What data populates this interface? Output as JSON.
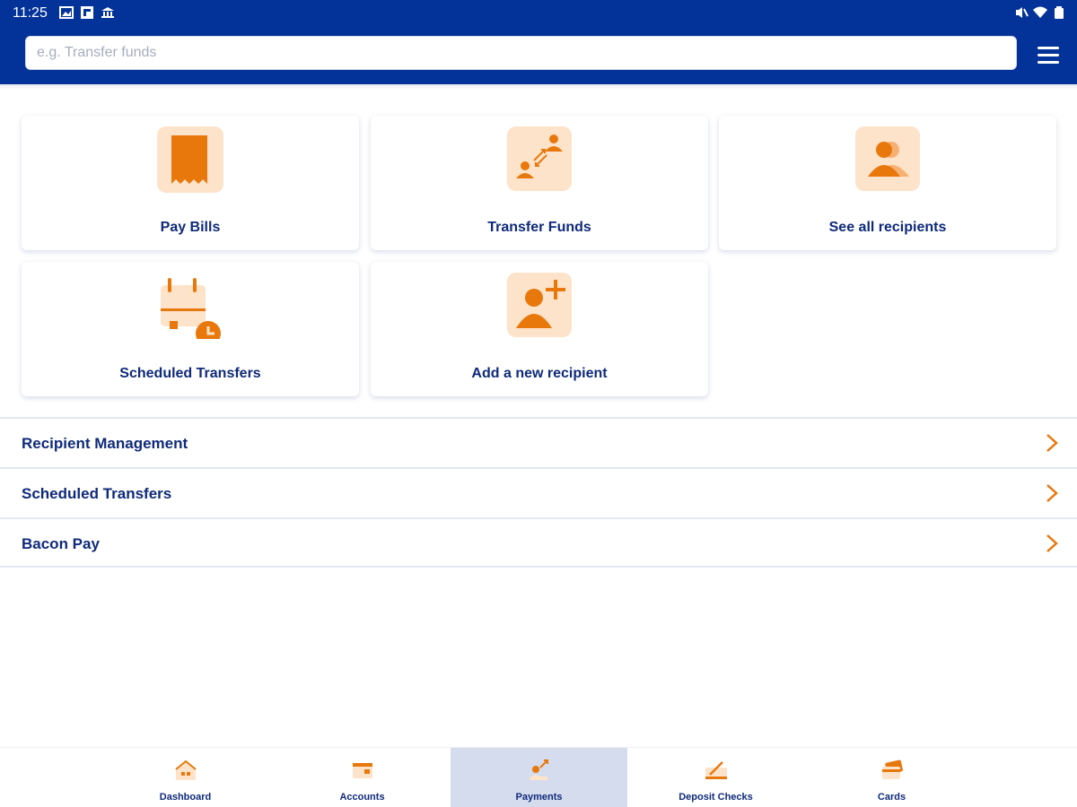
{
  "status_bar": {
    "time": "11:25"
  },
  "search": {
    "placeholder": "e.g. Transfer funds",
    "value": ""
  },
  "tiles": [
    {
      "label": "Pay Bills",
      "icon": "bill-receipt-icon"
    },
    {
      "label": "Transfer Funds",
      "icon": "transfer-people-icon"
    },
    {
      "label": "See all recipients",
      "icon": "recipients-group-icon"
    },
    {
      "label": "Scheduled Transfers",
      "icon": "calendar-clock-icon"
    },
    {
      "label": "Add a new recipient",
      "icon": "add-person-icon"
    }
  ],
  "list": [
    {
      "label": "Recipient Management"
    },
    {
      "label": "Scheduled Transfers"
    },
    {
      "label": "Bacon Pay"
    }
  ],
  "bottom_nav": {
    "items": [
      {
        "label": "Dashboard",
        "icon": "home-icon"
      },
      {
        "label": "Accounts",
        "icon": "wallet-icon"
      },
      {
        "label": "Payments",
        "icon": "payments-icon",
        "active": true
      },
      {
        "label": "Deposit Checks",
        "icon": "check-deposit-icon"
      },
      {
        "label": "Cards",
        "icon": "cards-icon"
      }
    ]
  },
  "colors": {
    "brand_blue": "#033399",
    "accent_orange": "#e8780c",
    "icon_bg": "#fde3c9",
    "text_navy": "#0f2a7a",
    "active_tab_bg": "#d5dced"
  }
}
